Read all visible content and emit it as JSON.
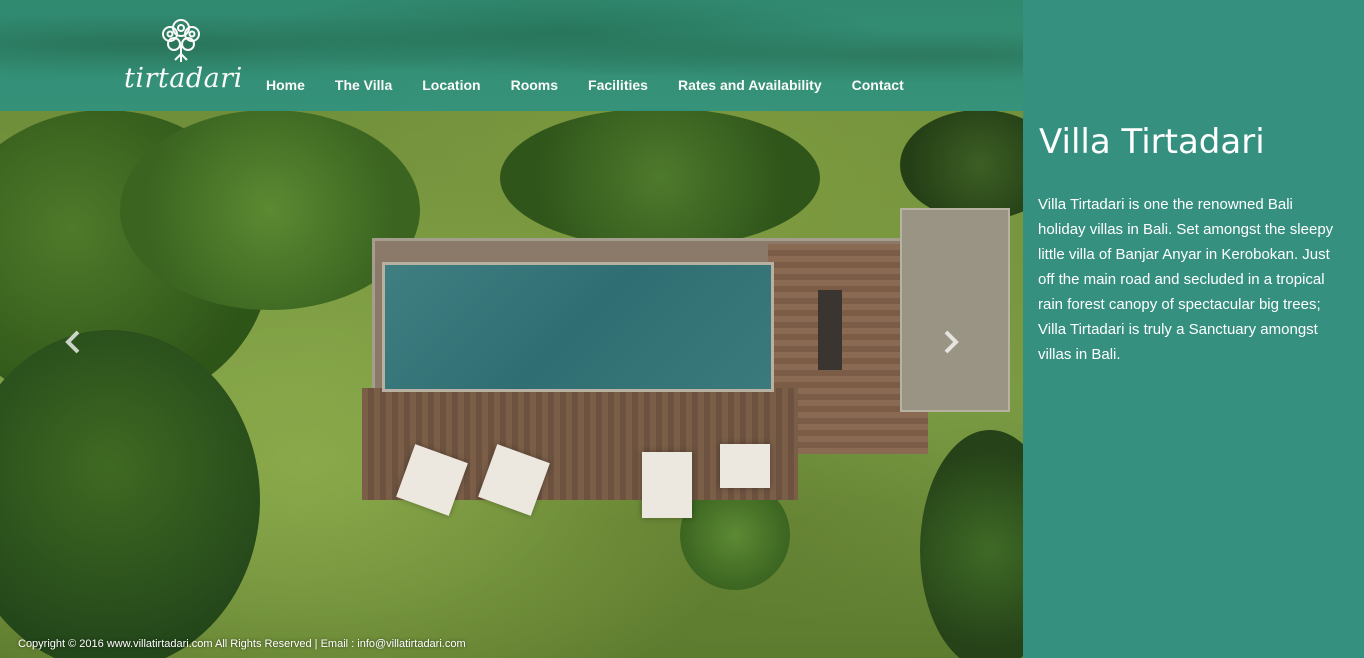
{
  "brand": {
    "logo_text": "tirtadari"
  },
  "nav": {
    "items": [
      {
        "label": "Home"
      },
      {
        "label": "The Villa"
      },
      {
        "label": "Location"
      },
      {
        "label": "Rooms"
      },
      {
        "label": "Facilities"
      },
      {
        "label": "Rates and Availability"
      },
      {
        "label": "Contact"
      }
    ]
  },
  "slider": {
    "prev_icon": "chevron-left-icon",
    "next_icon": "chevron-right-icon"
  },
  "footer": {
    "text": "Copyright © 2016 www.villatirtadari.com All Rights Reserved | Email : info@villatirtadari.com"
  },
  "panel": {
    "title": "Villa Tirtadari",
    "description": "Villa Tirtadari is one the renowned Bali holiday villas in Bali. Set amongst the sleepy little villa of Banjar Anyar in Kerobokan. Just off the main road and secluded in a tropical rain forest canopy of spectacular big trees; Villa Tirtadari is truly a Sanctuary amongst villas in Bali."
  },
  "colors": {
    "panel_bg": "#35907f",
    "header_bg": "#33907a",
    "text": "#ffffff"
  }
}
